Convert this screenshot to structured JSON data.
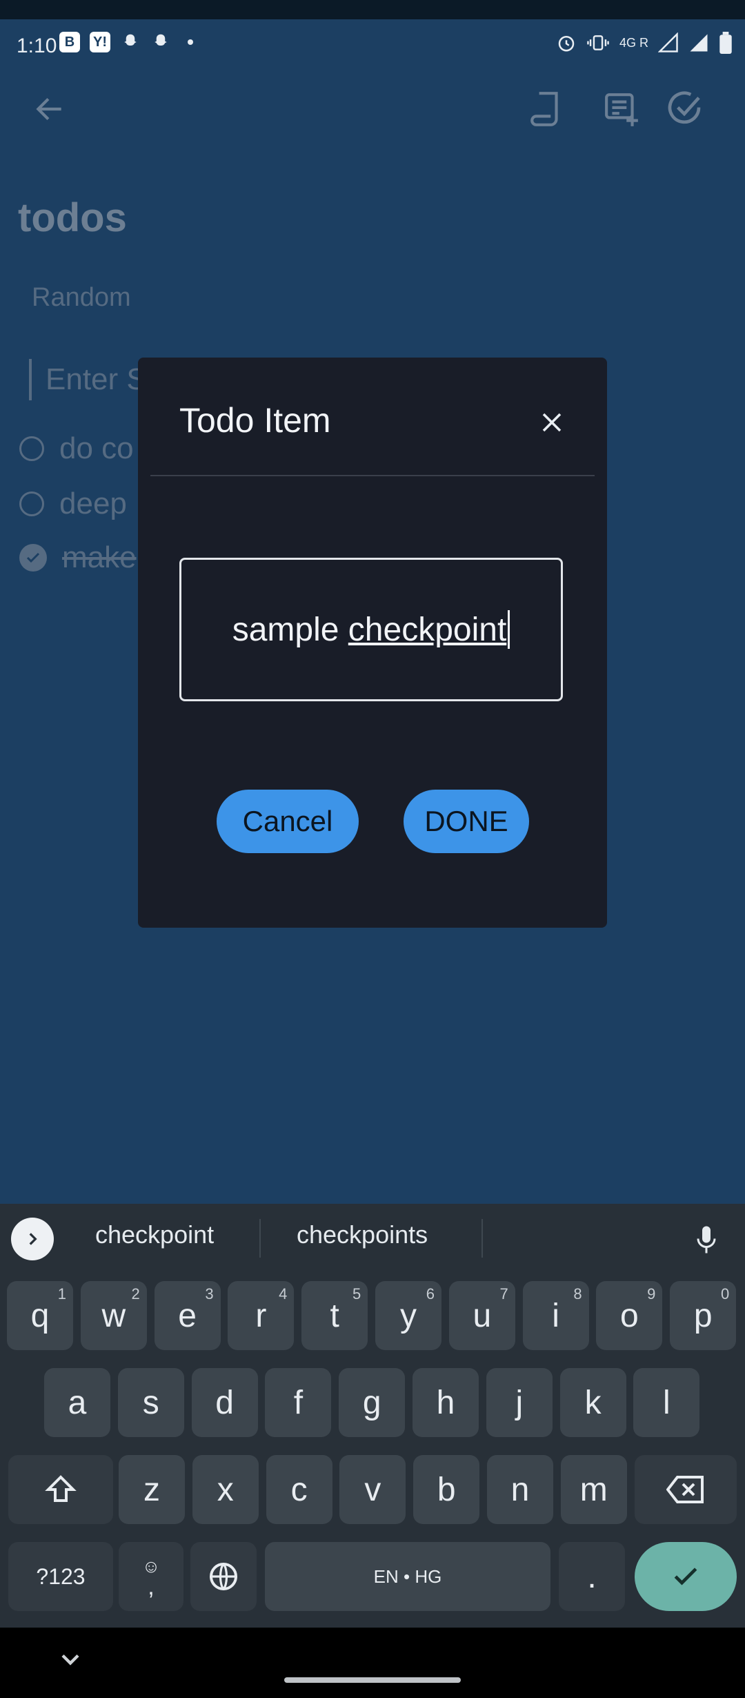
{
  "status_bar": {
    "time": "1:10",
    "left_badges": [
      "B",
      "Y!"
    ],
    "network": "4G R"
  },
  "app": {
    "title": "todos",
    "category": "Random",
    "input_placeholder": "Enter S",
    "todos": [
      {
        "label": "do co",
        "done": false
      },
      {
        "label": "deep",
        "done": false
      },
      {
        "label": "make",
        "done": true
      }
    ]
  },
  "dialog": {
    "title": "Todo Item",
    "field_value_word1": "sample",
    "field_value_word2": "checkpoint",
    "cancel_label": "Cancel",
    "done_label": "DONE"
  },
  "keyboard": {
    "suggestions": [
      "checkpoint",
      "checkpoints"
    ],
    "row1": [
      {
        "k": "q",
        "n": "1"
      },
      {
        "k": "w",
        "n": "2"
      },
      {
        "k": "e",
        "n": "3"
      },
      {
        "k": "r",
        "n": "4"
      },
      {
        "k": "t",
        "n": "5"
      },
      {
        "k": "y",
        "n": "6"
      },
      {
        "k": "u",
        "n": "7"
      },
      {
        "k": "i",
        "n": "8"
      },
      {
        "k": "o",
        "n": "9"
      },
      {
        "k": "p",
        "n": "0"
      }
    ],
    "row2": [
      "a",
      "s",
      "d",
      "f",
      "g",
      "h",
      "j",
      "k",
      "l"
    ],
    "row3": [
      "z",
      "x",
      "c",
      "v",
      "b",
      "n",
      "m"
    ],
    "symbols_label": "?123",
    "comma_label": ",",
    "space_label": "EN • HG",
    "period_label": "."
  },
  "colors": {
    "background": "#1c3f62",
    "dialog": "#191d28",
    "button": "#3d94e8",
    "enter_key": "#6cb3a8"
  }
}
